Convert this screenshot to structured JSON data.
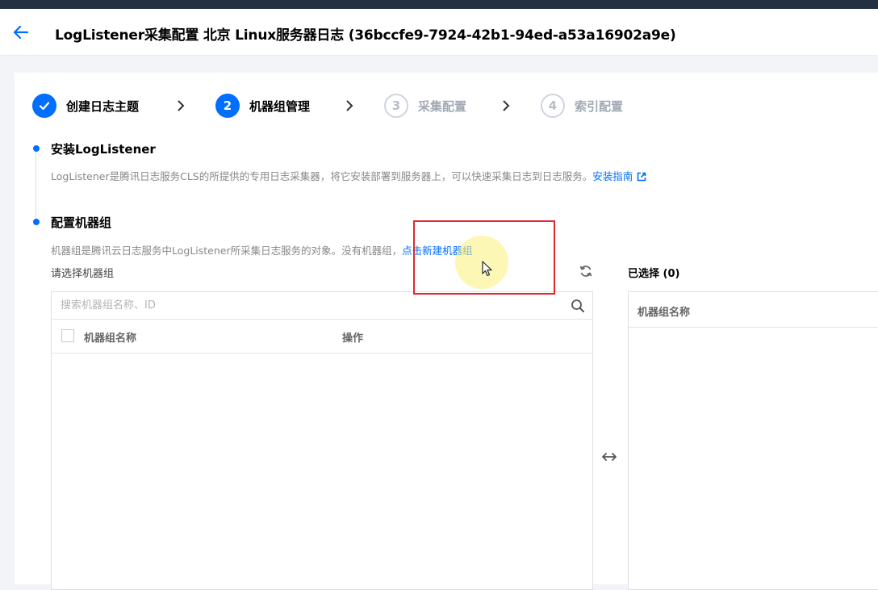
{
  "header": {
    "title": "LogListener采集配置 北京 Linux服务器日志 (36bccfe9-7924-42b1-94ed-a53a16902a9e)",
    "back_icon": "arrow-left-icon"
  },
  "steps": [
    {
      "number": "",
      "label": "创建日志主题",
      "state": "done"
    },
    {
      "number": "2",
      "label": "机器组管理",
      "state": "active"
    },
    {
      "number": "3",
      "label": "采集配置",
      "state": "todo"
    },
    {
      "number": "4",
      "label": "索引配置",
      "state": "todo"
    }
  ],
  "install": {
    "title": "安装LogListener",
    "desc": "LogListener是腾讯日志服务CLS的所提供的专用日志采集器，将它安装部署到服务器上，可以快速采集日志到日志服务。",
    "link": "安装指南"
  },
  "machine_group": {
    "title": "配置机器组",
    "desc": "机器组是腾讯云日志服务中LogListener所采集日志服务的对象。没有机器组，",
    "create_link": "点击新建机器组"
  },
  "left_panel": {
    "label": "请选择机器组",
    "search_placeholder": "搜索机器组名称、ID",
    "columns": [
      "机器组名称",
      "操作"
    ],
    "rows": []
  },
  "right_panel": {
    "label": "已选择 (0)",
    "columns": [
      "机器组名称"
    ],
    "rows": []
  },
  "colors": {
    "primary": "#006eff",
    "highlight_box": "#e0282e",
    "cursor_halo": "#fcf078"
  }
}
